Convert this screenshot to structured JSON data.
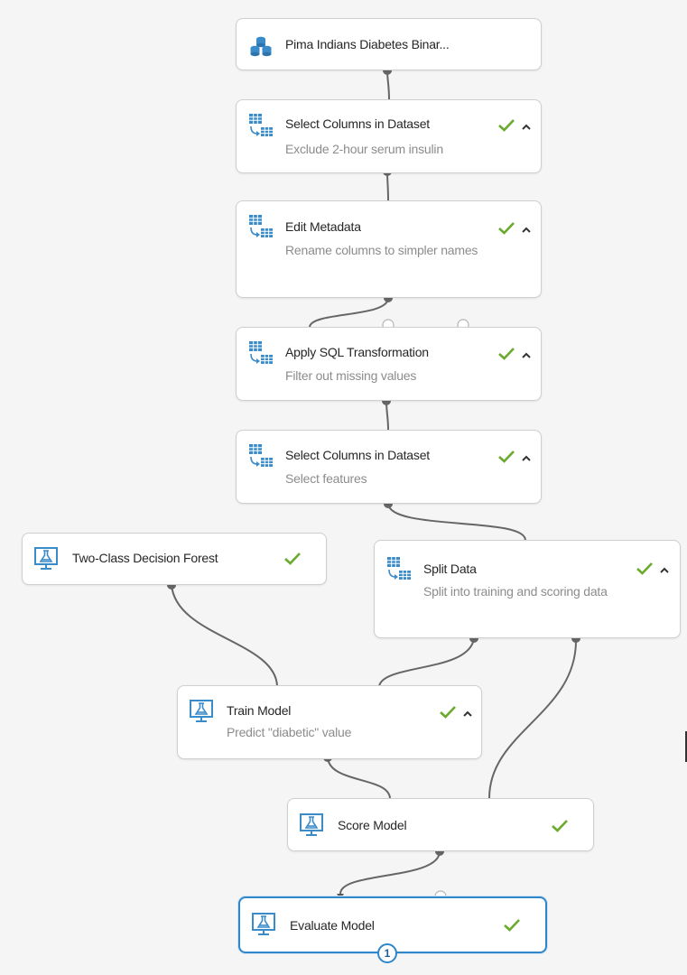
{
  "colors": {
    "check": "#6aaa2d",
    "selected_border": "#2f86c9",
    "edge": "#666666",
    "icon_blue": "#3a8bc9"
  },
  "modules": {
    "pima_dataset": {
      "title": "Pima Indians Diabetes Binar...",
      "icon": "database-icon"
    },
    "select_columns_1": {
      "title": "Select Columns in Dataset",
      "description": "Exclude 2-hour serum insulin",
      "status": "check-icon"
    },
    "edit_metadata": {
      "title": "Edit Metadata",
      "description": "Rename columns to simpler names",
      "status": "check-icon"
    },
    "apply_sql": {
      "title": "Apply SQL Transformation",
      "description": "Filter out missing values",
      "status": "check-icon"
    },
    "select_columns_2": {
      "title": "Select Columns in Dataset",
      "description": "Select features",
      "status": "check-icon"
    },
    "decision_forest": {
      "title": "Two-Class Decision Forest",
      "status": "check-icon"
    },
    "split_data": {
      "title": "Split Data",
      "description": "Split into training and scoring data",
      "status": "check-icon"
    },
    "train_model": {
      "title": "Train Model",
      "description": "Predict \"diabetic\" value",
      "status": "check-icon"
    },
    "score_model": {
      "title": "Score Model",
      "status": "check-icon"
    },
    "evaluate_model": {
      "title": "Evaluate Model",
      "status": "check-icon",
      "badge": "1"
    }
  }
}
